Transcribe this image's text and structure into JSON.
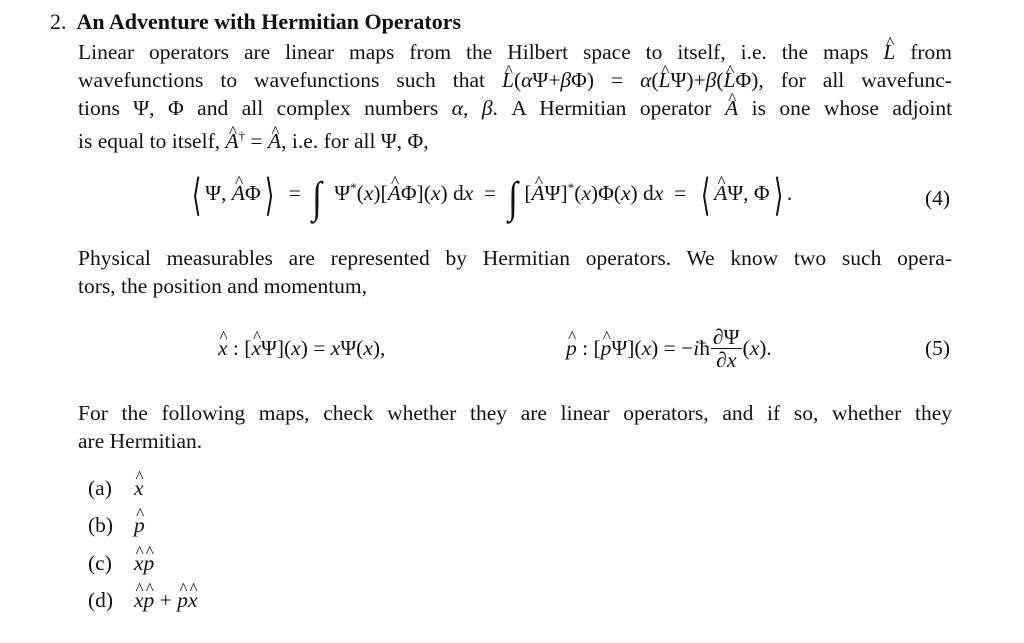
{
  "problem": {
    "number": "2.",
    "title": "An Adventure with Hermitian Operators"
  },
  "intro": {
    "lines": [
      "Linear operators are linear maps from the Hilbert space to itself, i.e.  the maps L̂ from",
      "wavefunctions to wavefunctions such that L̂(αΨ+βΦ) = α(L̂Ψ)+β(L̂Φ), for all wavefunc-",
      "tions Ψ, Φ and all complex numbers α, β.  A Hermitian operator Â is one whose adjoint",
      "is equal to itself, Â† = Â, i.e. for all Ψ, Φ,"
    ],
    "line1_text": "Linear operators are linear maps from the Hilbert space to itself, i.e.  the maps",
    "line1_tail": "from",
    "line2_head": "wavefunctions to wavefunctions such that",
    "line2_tail": ", for all wavefunc-",
    "line3_head": "tions Ψ, Φ and all complex numbers",
    "line3_mid": ".  A Hermitian operator",
    "line3_tail": "is one whose adjoint",
    "line4_head": "is equal to itself,",
    "line4_tail": ", i.e. for all Ψ, Φ,"
  },
  "equation4": {
    "latex": "\\left\\langle \\Psi, \\hat{A}\\Phi \\right\\rangle = \\int \\Psi^*(x)[\\hat{A}\\Phi](x)\\,\\mathrm{d}x = \\int [\\hat{A}\\Psi]^*(x)\\Phi(x)\\,\\mathrm{d}x = \\left\\langle \\hat{A}\\Psi, \\Phi \\right\\rangle.",
    "tag": "(4)"
  },
  "measurables": {
    "line1": "Physical measurables are represented by Hermitian operators.  We know two such opera-",
    "line2": "tors, the position and momentum,"
  },
  "equation5": {
    "position": "x̂ : [x̂Ψ](x) = xΨ(x),",
    "momentum": "p̂ : [p̂Ψ](x) = −iħ ∂Ψ/∂x (x).",
    "tag": "(5)"
  },
  "task": {
    "line1": "For the following maps, check whether they are linear operators, and if so, whether they",
    "line2": "are Hermitian."
  },
  "items": [
    {
      "label": "(a)",
      "expr": "x̂"
    },
    {
      "label": "(b)",
      "expr": "p̂"
    },
    {
      "label": "(c)",
      "expr": "x̂p̂"
    },
    {
      "label": "(d)",
      "expr": "x̂p̂ + p̂x̂"
    }
  ]
}
